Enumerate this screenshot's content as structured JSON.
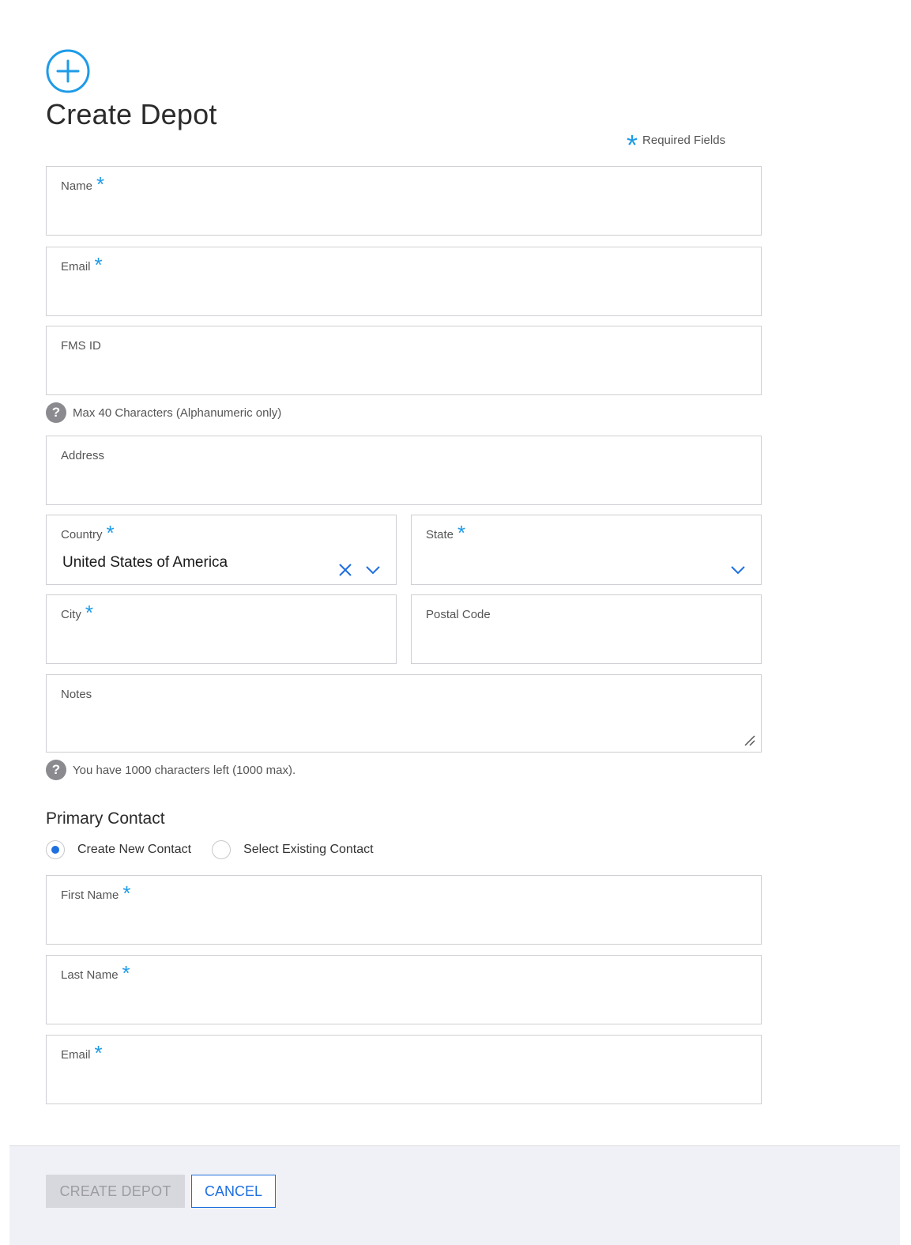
{
  "page": {
    "title": "Create Depot",
    "required_legend": "Required Fields",
    "required_mark": "*"
  },
  "fields": {
    "name": {
      "label": "Name"
    },
    "email": {
      "label": "Email"
    },
    "fms_id": {
      "label": "FMS ID",
      "hint": "Max 40 Characters (Alphanumeric only)"
    },
    "address": {
      "label": "Address"
    },
    "country": {
      "label": "Country",
      "value": "United States of America"
    },
    "state": {
      "label": "State"
    },
    "city": {
      "label": "City"
    },
    "postal_code": {
      "label": "Postal Code"
    },
    "notes": {
      "label": "Notes",
      "hint": "You have 1000 characters left (1000 max)."
    }
  },
  "primary_contact": {
    "title": "Primary Contact",
    "options": [
      "Create New Contact",
      "Select Existing Contact"
    ],
    "selected": "Create New Contact",
    "first_name": {
      "label": "First Name"
    },
    "last_name": {
      "label": "Last Name"
    },
    "email": {
      "label": "Email"
    }
  },
  "footer": {
    "create_label": "CREATE DEPOT",
    "cancel_label": "CANCEL"
  },
  "colors": {
    "accent": "#1e9be8",
    "primary": "#1e6fe0",
    "disabled_bg": "#d7d8dd"
  },
  "icons": {
    "add": "plus-circle-icon",
    "help": "question-icon",
    "clear": "close-icon",
    "dropdown": "chevron-down-icon"
  }
}
